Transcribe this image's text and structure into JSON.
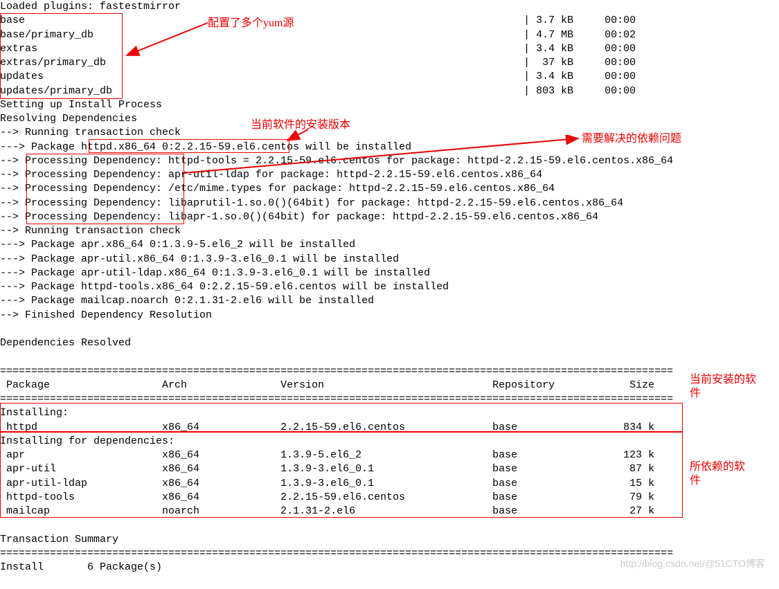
{
  "lines": [
    "Loaded plugins: fastestmirror",
    "base                                                                                | 3.7 kB     00:00",
    "base/primary_db                                                                     | 4.7 MB     00:02",
    "extras                                                                              | 3.4 kB     00:00",
    "extras/primary_db                                                                   |  37 kB     00:00",
    "updates                                                                             | 3.4 kB     00:00",
    "updates/primary_db                                                                  | 803 kB     00:00",
    "Setting up Install Process",
    "Resolving Dependencies",
    "--> Running transaction check",
    "---> Package httpd.x86_64 0:2.2.15-59.el6.centos will be installed",
    "--> Processing Dependency: httpd-tools = 2.2.15-59.el6.centos for package: httpd-2.2.15-59.el6.centos.x86_64",
    "--> Processing Dependency: apr-util-ldap for package: httpd-2.2.15-59.el6.centos.x86_64",
    "--> Processing Dependency: /etc/mime.types for package: httpd-2.2.15-59.el6.centos.x86_64",
    "--> Processing Dependency: libaprutil-1.so.0()(64bit) for package: httpd-2.2.15-59.el6.centos.x86_64",
    "--> Processing Dependency: libapr-1.so.0()(64bit) for package: httpd-2.2.15-59.el6.centos.x86_64",
    "--> Running transaction check",
    "---> Package apr.x86_64 0:1.3.9-5.el6_2 will be installed",
    "---> Package apr-util.x86_64 0:1.3.9-3.el6_0.1 will be installed",
    "---> Package apr-util-ldap.x86_64 0:1.3.9-3.el6_0.1 will be installed",
    "---> Package httpd-tools.x86_64 0:2.2.15-59.el6.centos will be installed",
    "---> Package mailcap.noarch 0:2.1.31-2.el6 will be installed",
    "--> Finished Dependency Resolution",
    "",
    "Dependencies Resolved",
    "",
    "============================================================================================================",
    " Package                  Arch               Version                           Repository            Size",
    "============================================================================================================",
    "Installing:",
    " httpd                    x86_64             2.2.15-59.el6.centos              base                 834 k",
    "Installing for dependencies:",
    " apr                      x86_64             1.3.9-5.el6_2                     base                 123 k",
    " apr-util                 x86_64             1.3.9-3.el6_0.1                   base                  87 k",
    " apr-util-ldap            x86_64             1.3.9-3.el6_0.1                   base                  15 k",
    " httpd-tools              x86_64             2.2.15-59.el6.centos              base                  79 k",
    " mailcap                  noarch             2.1.31-2.el6                      base                  27 k",
    "",
    "Transaction Summary",
    "============================================================================================================",
    "Install       6 Package(s)"
  ],
  "annotations": {
    "yum_sources": "配置了多个yum源",
    "install_version": "当前软件的安装版本",
    "deps_issue": "需要解决的依赖问题",
    "current_pkg_1": "当前安装的软",
    "current_pkg_2": "件",
    "dep_pkg_1": "所依赖的软",
    "dep_pkg_2": "件"
  },
  "watermark": "http://blog.csdn.net/@51CTO博客"
}
